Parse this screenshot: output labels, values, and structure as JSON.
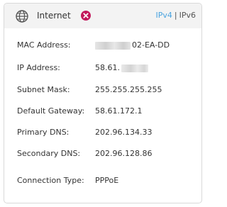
{
  "header": {
    "icon": "globe-icon",
    "title": "Internet",
    "status_icon": "error-x-icon",
    "status_color": "#c2185b",
    "ipv4_label": "IPv4",
    "separator": "|",
    "ipv6_label": "IPv6",
    "active_tab": "IPv4",
    "accent_color": "#4aa3df"
  },
  "fields": {
    "mac_label": "MAC Address:",
    "mac_value_visible": "02-EA-DD",
    "ip_label": "IP Address:",
    "ip_value_visible": "58.61.",
    "subnet_label": "Subnet Mask:",
    "subnet_value": "255.255.255.255",
    "gateway_label": "Default Gateway:",
    "gateway_value": "58.61.172.1",
    "primary_dns_label": "Primary DNS:",
    "primary_dns_value": "202.96.134.33",
    "secondary_dns_label": "Secondary DNS:",
    "secondary_dns_value": "202.96.128.86",
    "connection_type_label": "Connection Type:",
    "connection_type_value": "PPPoE"
  }
}
